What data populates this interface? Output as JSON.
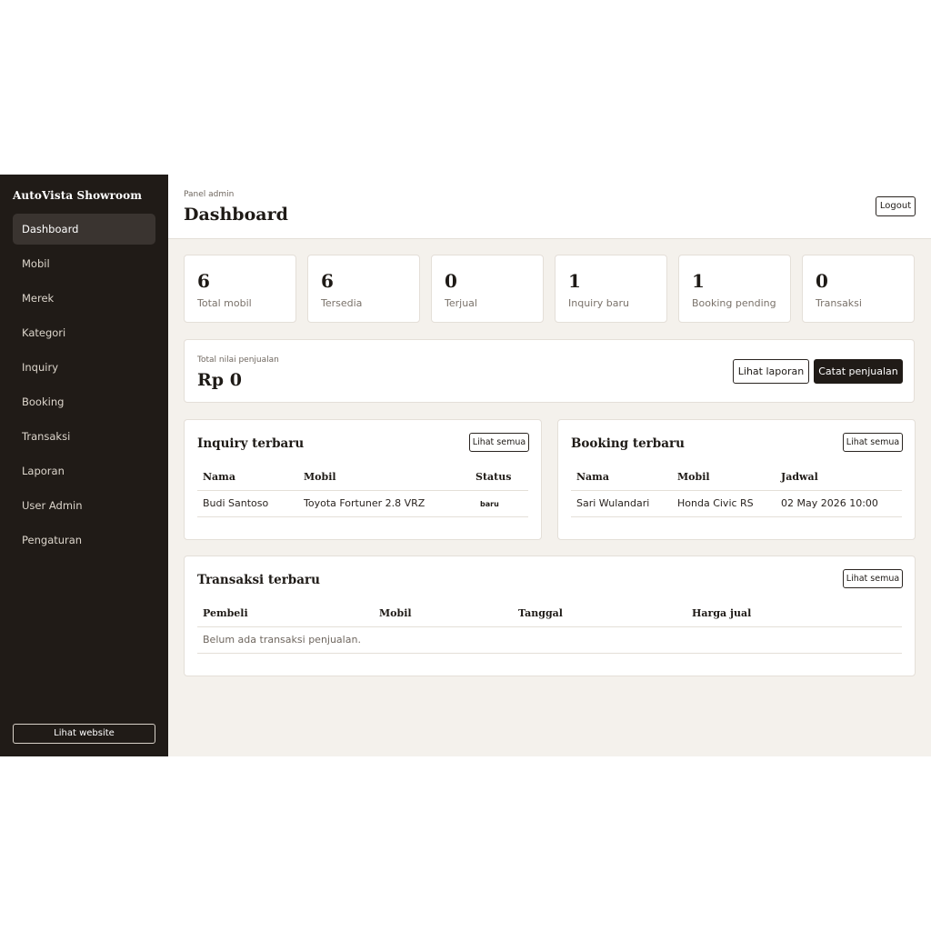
{
  "sidebar": {
    "brand": "AutoVista Showroom",
    "items": [
      {
        "label": "Dashboard",
        "active": true
      },
      {
        "label": "Mobil"
      },
      {
        "label": "Merek"
      },
      {
        "label": "Kategori"
      },
      {
        "label": "Inquiry"
      },
      {
        "label": "Booking"
      },
      {
        "label": "Transaksi"
      },
      {
        "label": "Laporan"
      },
      {
        "label": "User Admin"
      },
      {
        "label": "Pengaturan"
      }
    ],
    "site_button": "Lihat website"
  },
  "header": {
    "breadcrumb": "Panel admin",
    "title": "Dashboard",
    "logout_label": "Logout"
  },
  "stats": [
    {
      "value": "6",
      "label": "Total mobil"
    },
    {
      "value": "6",
      "label": "Tersedia"
    },
    {
      "value": "0",
      "label": "Terjual"
    },
    {
      "value": "1",
      "label": "Inquiry baru"
    },
    {
      "value": "1",
      "label": "Booking pending"
    },
    {
      "value": "0",
      "label": "Transaksi"
    }
  ],
  "sales": {
    "label": "Total nilai penjualan",
    "value": "Rp 0",
    "report_button": "Lihat laporan",
    "record_button": "Catat penjualan"
  },
  "inquiry": {
    "title": "Inquiry terbaru",
    "see_all": "Lihat semua",
    "columns": [
      "Nama",
      "Mobil",
      "Status"
    ],
    "rows": [
      {
        "name": "Budi Santoso",
        "car": "Toyota Fortuner 2.8 VRZ",
        "status": "baru"
      }
    ]
  },
  "booking": {
    "title": "Booking terbaru",
    "see_all": "Lihat semua",
    "columns": [
      "Nama",
      "Mobil",
      "Jadwal"
    ],
    "rows": [
      {
        "name": "Sari Wulandari",
        "car": "Honda Civic RS",
        "schedule": "02 May 2026 10:00"
      }
    ]
  },
  "transactions": {
    "title": "Transaksi terbaru",
    "see_all": "Lihat semua",
    "columns": [
      "Pembeli",
      "Mobil",
      "Tanggal",
      "Harga jual"
    ],
    "empty": "Belum ada transaksi penjualan."
  }
}
